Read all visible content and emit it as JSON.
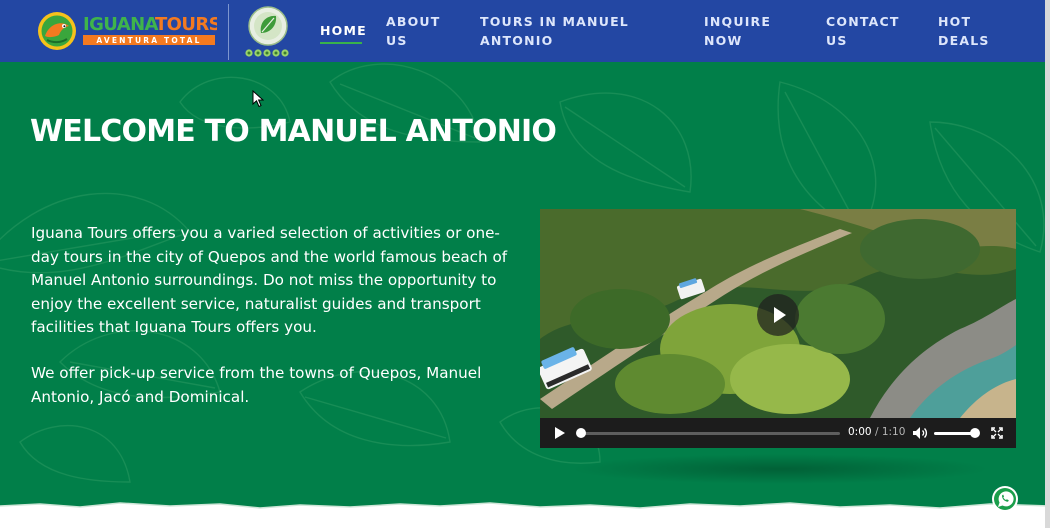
{
  "header": {
    "logo_text": "IGUANATOURS",
    "logo_tagline": "AVENTURA TOTAL",
    "nav": [
      {
        "line1": "HOME",
        "line2": ""
      },
      {
        "line1": "ABOUT",
        "line2": "US"
      },
      {
        "line1": "TOURS IN MANUEL",
        "line2": "ANTONIO"
      },
      {
        "line1": "INQUIRE",
        "line2": "NOW"
      },
      {
        "line1": "CONTACT",
        "line2": "US"
      },
      {
        "line1": "HOT",
        "line2": "DEALS"
      }
    ],
    "active_item": "HOME"
  },
  "hero": {
    "title": "WELCOME TO MANUEL ANTONIO",
    "paragraph1": "Iguana Tours offers you a varied selection of activities or one-day tours in the city of Quepos and the world famous beach of Manuel Antonio surroundings. Do not miss the opportunity to enjoy the excellent service, naturalist guides and transport facilities that Iguana Tours offers you.",
    "paragraph2": "We offer pick-up service from the towns of Quepos, Manuel Antonio, Jacó and Dominical."
  },
  "video": {
    "current_time": "0:00",
    "separator": "/",
    "duration": "1:10",
    "progress": 0,
    "volume": 1.0
  },
  "colors": {
    "header_bg": "#2347a3",
    "hero_bg": "#017f49",
    "accent_green": "#39b24a",
    "logo_orange": "#f47a20"
  },
  "icons": [
    "iguana-logo-icon",
    "certification-badge-icon",
    "play-icon",
    "volume-icon",
    "fullscreen-icon",
    "whatsapp-icon",
    "mouse-cursor-icon"
  ]
}
